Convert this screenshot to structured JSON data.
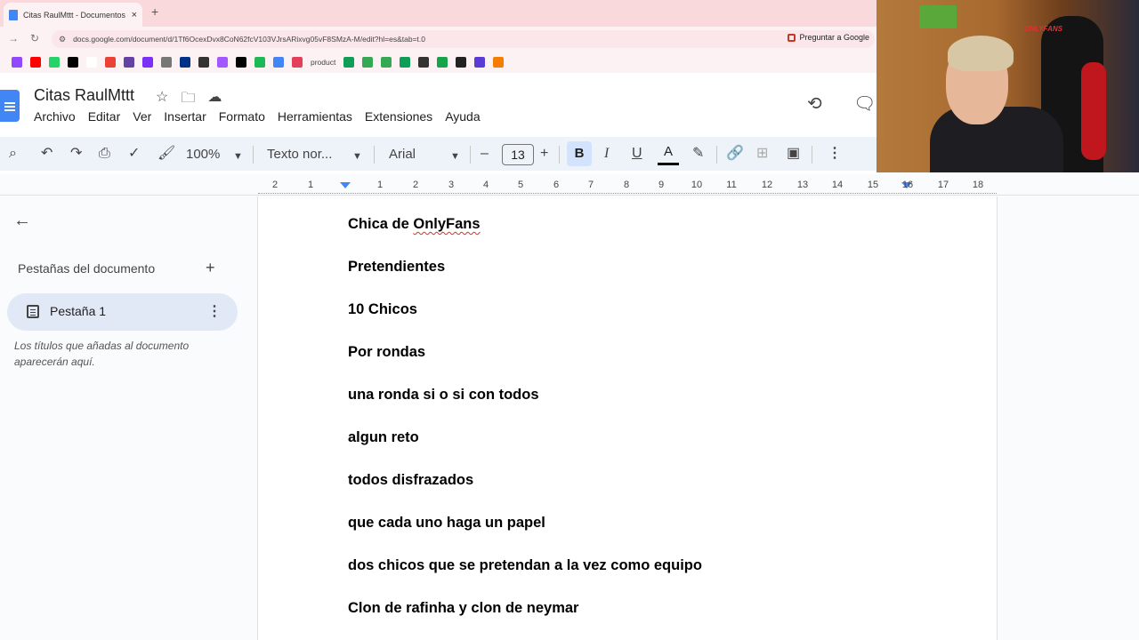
{
  "browser": {
    "tab_title": "Citas RaulMttt - Documentos de Google",
    "tab_close": "×",
    "new_tab": "+",
    "url": "docs.google.com/document/d/1Tf6OcexDvx8CoN62fcV103VJrsARixvg05vF8SMzA-M/edit?hl=es&tab=t.0",
    "ask_google": "Preguntar a Google",
    "bookmark_label": "product",
    "bookmark_colors": [
      "#9146ff",
      "#ff0000",
      "#25d366",
      "#000000",
      "#ffffff",
      "#ea4335",
      "#6441a5",
      "#7b2ff7",
      "#777777",
      "#003087",
      "#333333",
      "#a259ff",
      "#000000",
      "#1db954",
      "#4285f4",
      "#e43f5a",
      "#0f9d58",
      "#34a853",
      "#34a853",
      "#0f9d58",
      "#333333",
      "#16a34a",
      "#222222",
      "#5b3bd6",
      "#f57c00"
    ]
  },
  "docs": {
    "title": "Citas RaulMttt",
    "menu": [
      "Archivo",
      "Editar",
      "Ver",
      "Insertar",
      "Formato",
      "Herramientas",
      "Extensiones",
      "Ayuda"
    ],
    "zoom": "100%",
    "style": "Texto nor...",
    "font": "Arial",
    "font_size": "13",
    "minus": "–",
    "plus": "+",
    "bold_label": "B",
    "italic_label": "I",
    "underline_label": "U",
    "text_color_label": "A"
  },
  "ruler": {
    "labels": [
      "2",
      "1",
      "1",
      "2",
      "3",
      "4",
      "5",
      "6",
      "7",
      "8",
      "9",
      "10",
      "11",
      "12",
      "13",
      "14",
      "15",
      "16",
      "17",
      "18"
    ]
  },
  "sidepanel": {
    "title": "Pestañas del documento",
    "add": "+",
    "tab_label": "Pestaña 1",
    "hint": "Los títulos que añadas al documento aparecerán aquí."
  },
  "document": {
    "line0_a": "Chica de ",
    "line0_b": "OnlyFans",
    "lines": [
      "Pretendientes",
      "10 Chicos",
      "Por rondas",
      "una ronda si o si con todos",
      "algun reto",
      "todos disfrazados",
      "que cada uno haga un papel",
      "dos chicos que se pretendan a la vez como equipo",
      "Clon de rafinha y clon de neymar"
    ]
  },
  "webcam": {
    "chair_logo": "ONLYFANS"
  }
}
